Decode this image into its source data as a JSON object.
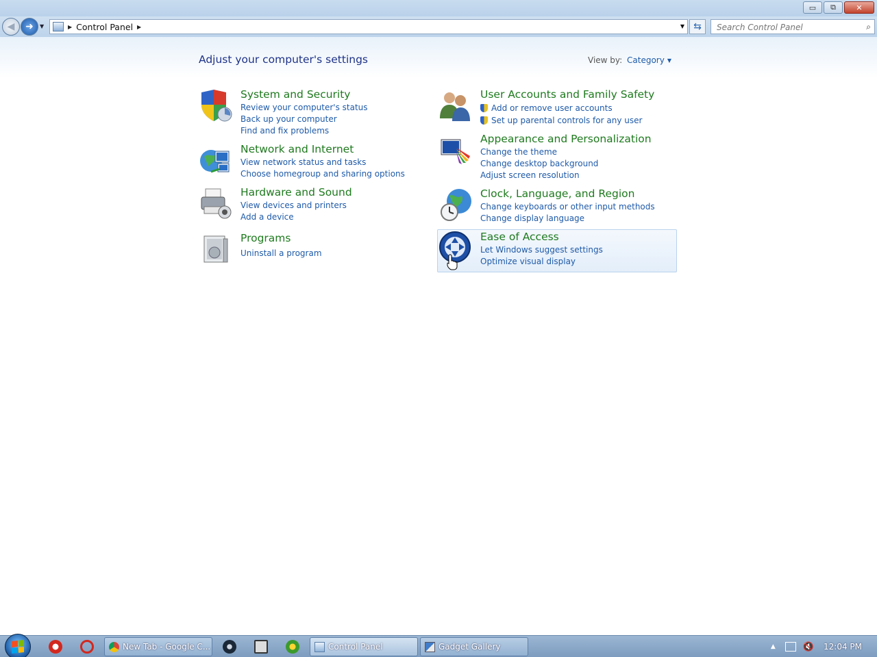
{
  "window": {
    "minimize_label": "▭",
    "restore_label": "⧉",
    "close_label": "✕"
  },
  "nav": {
    "breadcrumb": "Control Panel",
    "search_placeholder": "Search Control Panel"
  },
  "main": {
    "title": "Adjust your computer's settings",
    "view_by_label": "View by:",
    "view_by_value": "Category"
  },
  "categories": [
    {
      "title": "System and Security",
      "icon": "shield-icon",
      "links": [
        "Review your computer's status",
        "Back up your computer",
        "Find and fix problems"
      ]
    },
    {
      "title": "Network and Internet",
      "icon": "network-globe-icon",
      "links": [
        "View network status and tasks",
        "Choose homegroup and sharing options"
      ]
    },
    {
      "title": "Hardware and Sound",
      "icon": "printer-icon",
      "links": [
        "View devices and printers",
        "Add a device"
      ]
    },
    {
      "title": "Programs",
      "icon": "programs-icon",
      "links": [
        "Uninstall a program"
      ]
    },
    {
      "title": "User Accounts and Family Safety",
      "icon": "users-icon",
      "links": [
        "Add or remove user accounts",
        "Set up parental controls for any user"
      ]
    },
    {
      "title": "Appearance and Personalization",
      "icon": "monitor-palette-icon",
      "links": [
        "Change the theme",
        "Change desktop background",
        "Adjust screen resolution"
      ]
    },
    {
      "title": "Clock, Language, and Region",
      "icon": "clock-globe-icon",
      "links": [
        "Change keyboards or other input methods",
        "Change display language"
      ]
    },
    {
      "title": "Ease of Access",
      "icon": "ease-of-access-icon",
      "links": [
        "Let Windows suggest settings",
        "Optimize visual display"
      ]
    }
  ],
  "taskbar": {
    "tasks": [
      {
        "label": "New Tab - Google C...",
        "icon": "chrome-icon"
      },
      {
        "label": "Control Panel",
        "icon": "control-panel-icon"
      },
      {
        "label": "Gadget Gallery",
        "icon": "gadget-icon"
      }
    ],
    "clock": "12:04 PM"
  },
  "colors": {
    "category_title": "#1e7a1e",
    "link": "#1e5aa8",
    "heading": "#1e3287"
  }
}
